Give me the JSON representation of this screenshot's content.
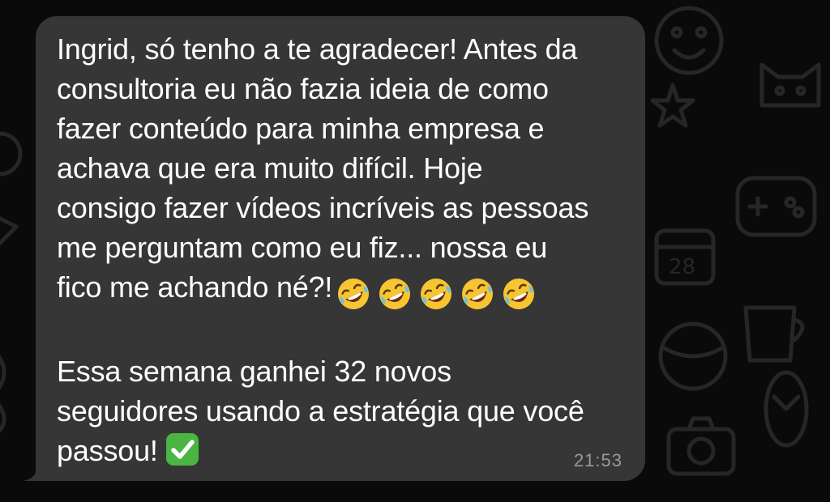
{
  "message": {
    "line1": "Ingrid, só tenho a te agradecer! Antes da\nconsultoria eu não fazia ideia de como\nfazer conteúdo para minha empresa e\nachava que era muito difícil. Hoje\nconsigo fazer vídeos incríveis as pessoas\nme perguntam como eu fiz... nossa eu\nfico me achando né?!",
    "emoji_reaction": "rolling-on-floor-laughing",
    "emoji_count": 5,
    "line2": "Essa semana ganhei 32 novos\nseguidores usando a estratégia que você\npassou!",
    "check_emoji": "white-heavy-check-mark",
    "timestamp": "21:53"
  },
  "colors": {
    "background": "#0a0a0a",
    "bubble": "#363636",
    "text": "#ffffff",
    "timestamp": "#9a9a9a",
    "check_green": "#4bb543"
  }
}
